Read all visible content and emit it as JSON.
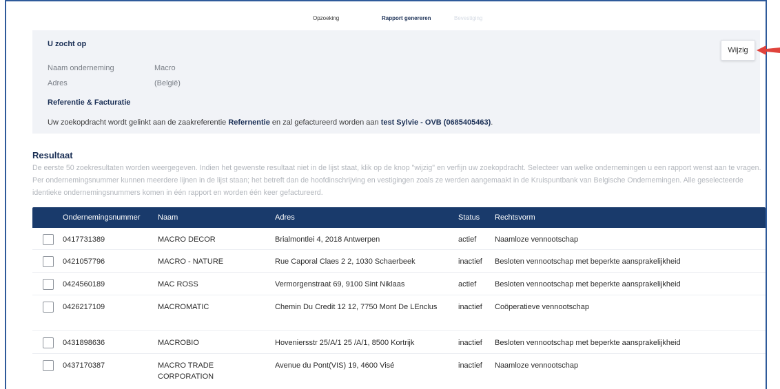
{
  "steps": [
    "Opzoeking",
    "Rapport genereren",
    "Bevestiging"
  ],
  "search": {
    "title": "U zocht op",
    "company_label": "Naam onderneming",
    "company_value": "Macro",
    "address_label": "Adres",
    "address_value": "(België)",
    "edit_label": "Wijzig"
  },
  "reference": {
    "title": "Referentie & Facturatie",
    "text_before": "Uw zoekopdracht wordt gelinkt aan de zaakreferentie ",
    "reference_name": "Refernentie",
    "text_middle": " en zal gefactureerd worden aan ",
    "billing_name": "test Sylvie - OVB (0685405463)",
    "text_after": "."
  },
  "results": {
    "title": "Resultaat",
    "description": "De eerste 50 zoekresultaten worden weergegeven. Indien het gewenste resultaat niet in de lijst staat, klik op de knop \"wijzig\" en verfijn uw zoekopdracht. Selecteer van welke ondernemingen u een rapport wenst aan te vragen. Per ondernemingsnummer kunnen meerdere lijnen in de lijst staan; het betreft dan de hoofdinschrijving en vestigingen zoals ze werden aangemaakt in de Kruispuntbank van Belgische Ondernemingen. Alle geselecteerde identieke ondernemingsnummers komen in één rapport en worden één keer gefactureerd."
  },
  "table": {
    "headers": [
      "Ondernemingsnummer",
      "Naam",
      "Adres",
      "Status",
      "Rechtsvorm"
    ],
    "rows": [
      {
        "number": "0417731389",
        "name": "MACRO DECOR",
        "address": "Brialmontlei 4, 2018 Antwerpen",
        "status": "actief",
        "form": "Naamloze vennootschap"
      },
      {
        "number": "0421057796",
        "name": "MACRO - NATURE",
        "address": "Rue Caporal Claes 2 2, 1030 Schaerbeek",
        "status": "inactief",
        "form": "Besloten vennootschap met beperkte aansprakelijkheid"
      },
      {
        "number": "0424560189",
        "name": "MAC ROSS",
        "address": "Vermorgenstraat 69, 9100 Sint Niklaas",
        "status": "actief",
        "form": "Besloten vennootschap met beperkte aansprakelijkheid"
      },
      {
        "number": "0426217109",
        "name": "MACROMATIC",
        "address": "Chemin Du Credit 12 12, 7750 Mont De LEnclus",
        "status": "inactief",
        "form": "Coöperatieve vennootschap"
      },
      {
        "number": "0431898636",
        "name": "MACROBIO",
        "address": "Hoveniersstr 25/A/1 25 /A/1, 8500 Kortrijk",
        "status": "inactief",
        "form": "Besloten vennootschap met beperkte aansprakelijkheid"
      },
      {
        "number": "0437170387",
        "name": "MACRO TRADE CORPORATION",
        "address": "Avenue du Pont(VIS) 19, 4600 Visé",
        "status": "inactief",
        "form": "Naamloze vennootschap"
      }
    ]
  },
  "colors": {
    "header_bg": "#193a6b",
    "accent_arrow": "#e0433c",
    "panel_bg": "#f1f3f7"
  }
}
